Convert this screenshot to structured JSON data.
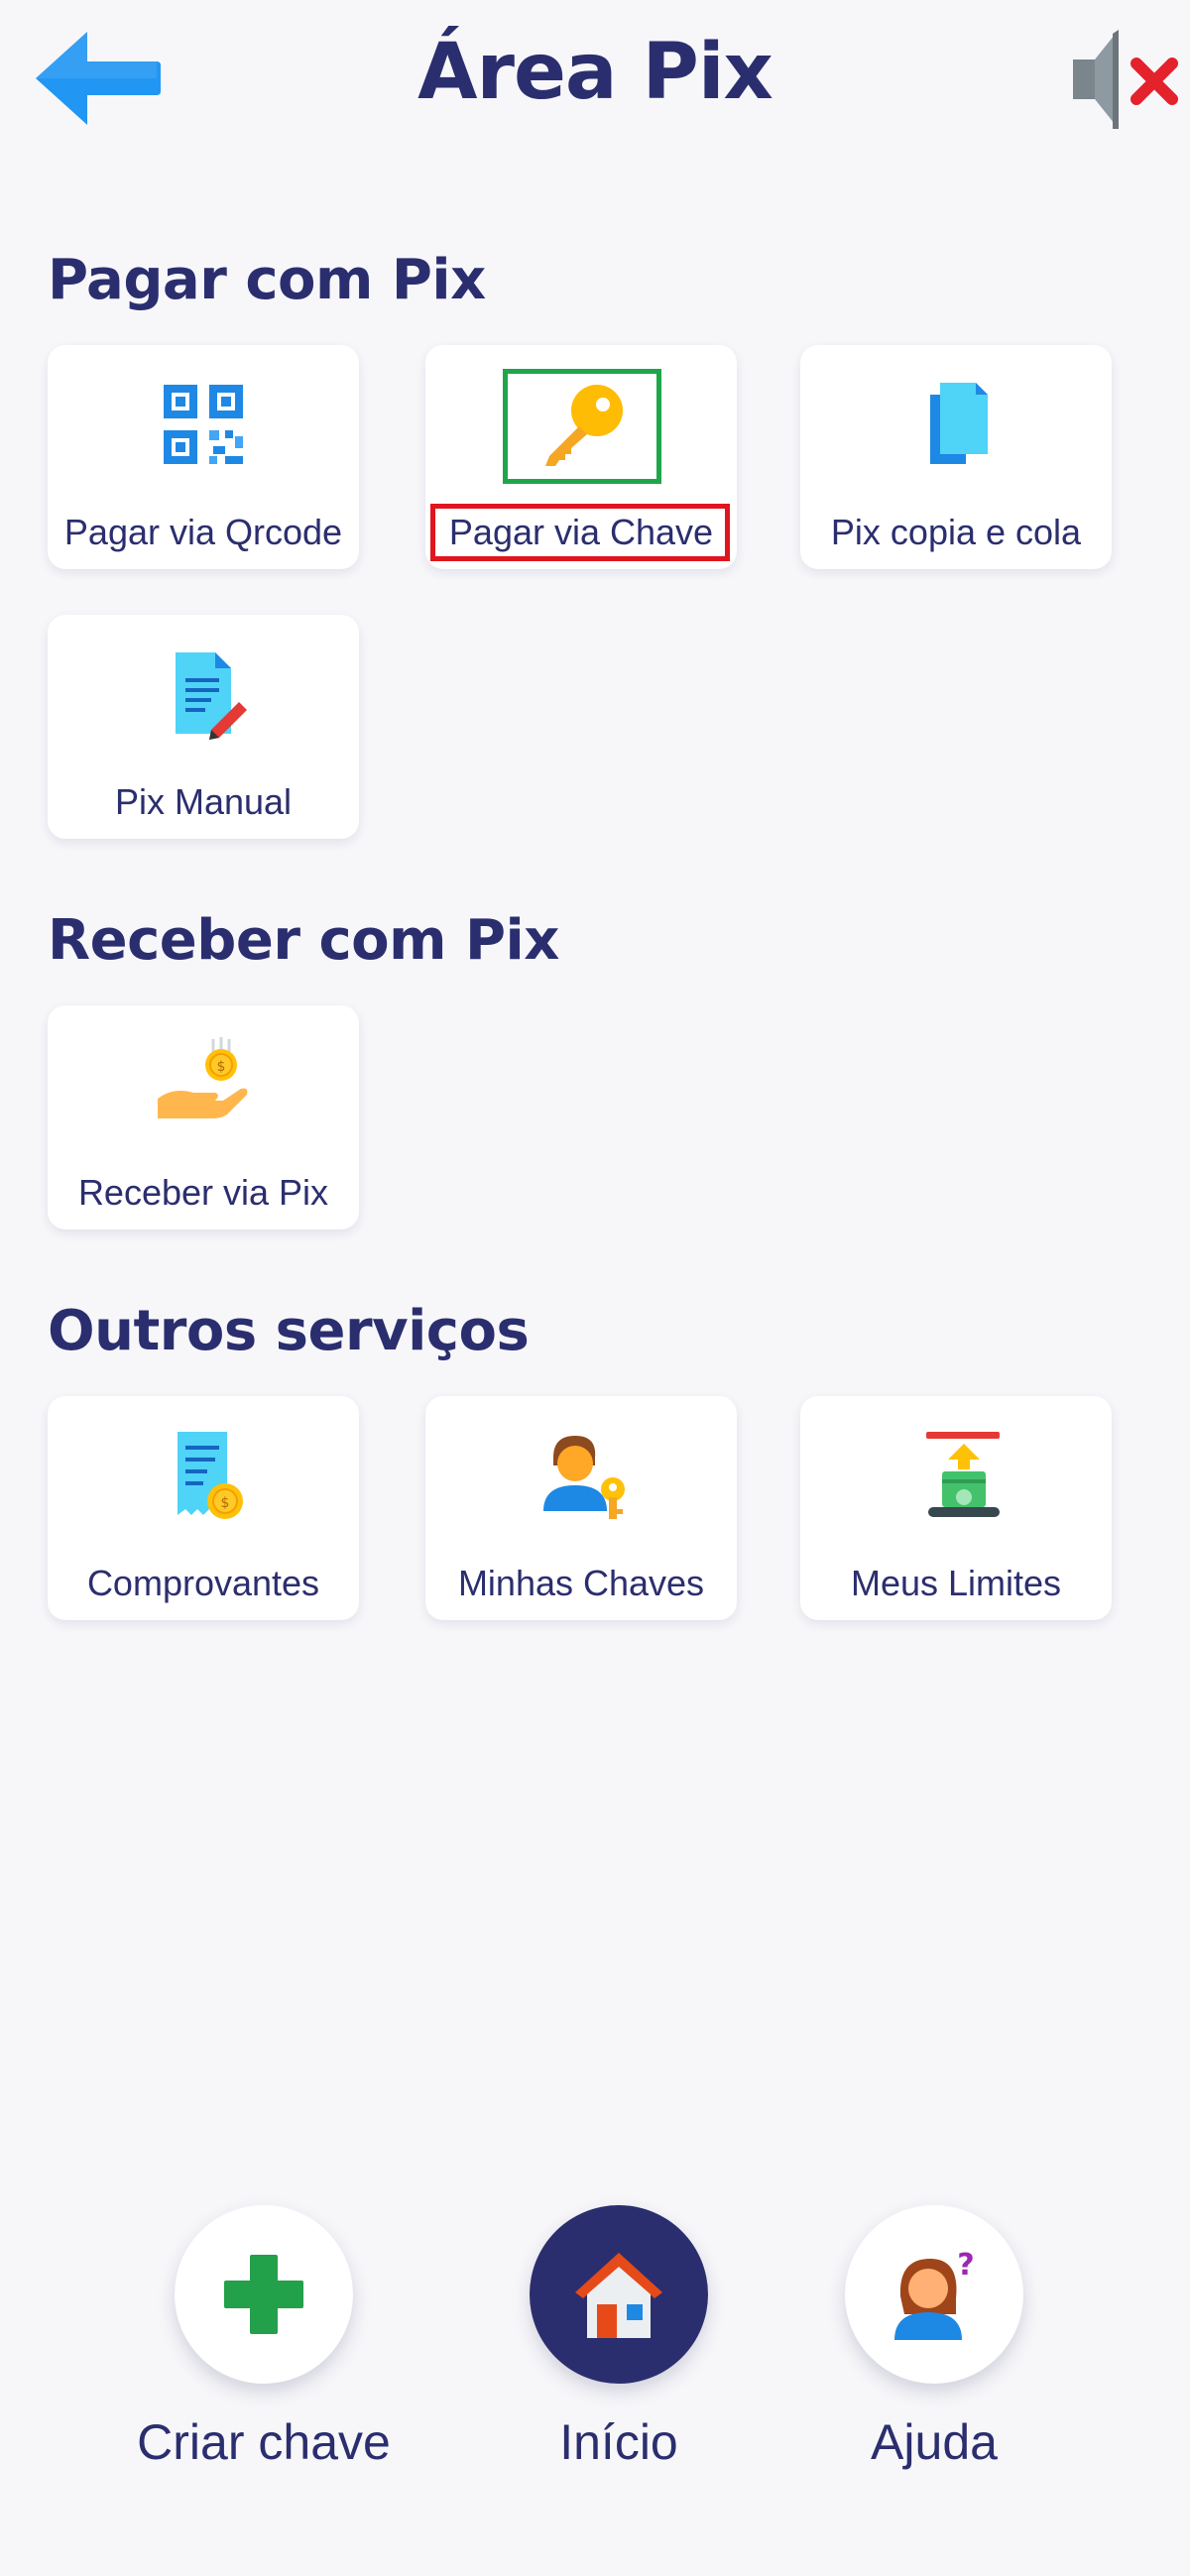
{
  "header": {
    "title": "Área Pix",
    "back_icon": "arrow-left-icon",
    "sound_icon": "speaker-muted-icon"
  },
  "sections": [
    {
      "title": "Pagar com Pix",
      "cards": [
        {
          "label": "Pagar via Qrcode",
          "icon": "qrcode-icon"
        },
        {
          "label": "Pagar via Chave",
          "icon": "key-icon"
        },
        {
          "label": "Pix copia e cola",
          "icon": "copy-document-icon"
        },
        {
          "label": "Pix Manual",
          "icon": "document-edit-icon"
        }
      ]
    },
    {
      "title": "Receber com Pix",
      "cards": [
        {
          "label": "Receber via Pix",
          "icon": "hand-coin-icon"
        }
      ]
    },
    {
      "title": "Outros serviços",
      "cards": [
        {
          "label": "Comprovantes",
          "icon": "receipt-icon"
        },
        {
          "label": "Minhas Chaves",
          "icon": "user-key-icon"
        },
        {
          "label": "Meus Limites",
          "icon": "limits-icon"
        }
      ]
    }
  ],
  "bottom_nav": [
    {
      "label": "Criar chave",
      "icon": "plus-icon",
      "active": false
    },
    {
      "label": "Início",
      "icon": "home-icon",
      "active": true
    },
    {
      "label": "Ajuda",
      "icon": "help-person-icon",
      "active": false
    }
  ],
  "colors": {
    "primary": "#2b2e6e",
    "background": "#f7f7fa",
    "accent_blue": "#2196f3",
    "highlight_green": "#1fa64a",
    "highlight_red": "#e0151d"
  }
}
